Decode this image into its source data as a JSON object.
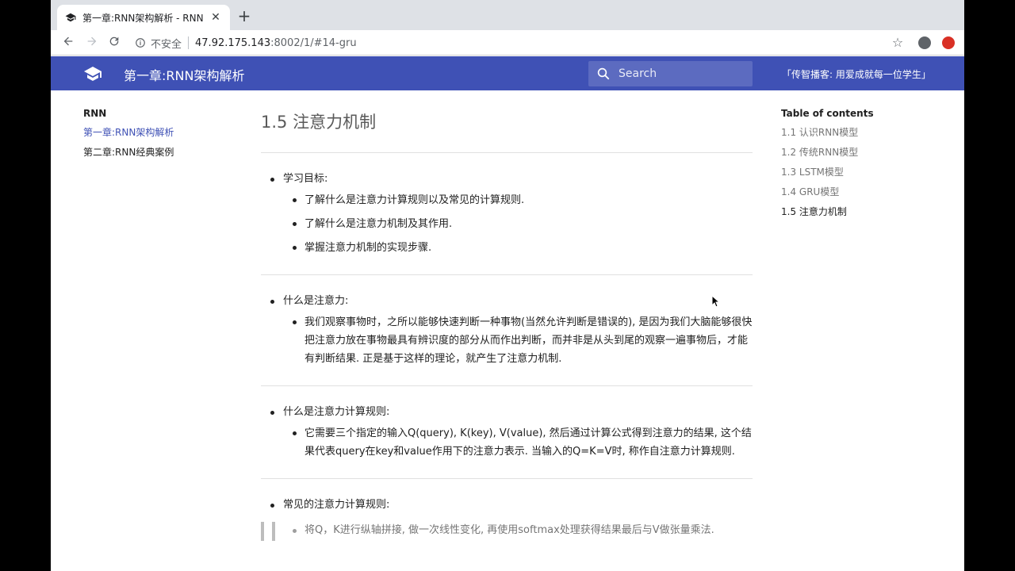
{
  "browser": {
    "tab_title": "第一章:RNN架构解析 - RNN",
    "tab_close": "✕",
    "new_tab": "+",
    "insecure_label": "不安全",
    "url_host": "47.92.175.143",
    "url_path": ":8002/1/#14-gru"
  },
  "header": {
    "title": "第一章:RNN架构解析",
    "search_placeholder": "Search",
    "slogan": "「传智播客: 用爱成就每一位学生」",
    "brand_color": "#3f51b5"
  },
  "left_nav": {
    "title": "RNN",
    "items": [
      {
        "label": "第一章:RNN架构解析"
      },
      {
        "label": "第二章:RNN经典案例"
      }
    ]
  },
  "toc": {
    "title": "Table of contents",
    "items": [
      {
        "label": "1.1 认识RNN模型"
      },
      {
        "label": "1.2 传统RNN模型"
      },
      {
        "label": "1.3 LSTM模型"
      },
      {
        "label": "1.4 GRU模型"
      },
      {
        "label": "1.5 注意力机制"
      }
    ]
  },
  "main": {
    "title": "1.5 注意力机制",
    "sections": [
      {
        "head": "学习目标:",
        "items": [
          "了解什么是注意力计算规则以及常见的计算规则.",
          "了解什么是注意力机制及其作用.",
          "掌握注意力机制的实现步骤."
        ]
      },
      {
        "head": "什么是注意力:",
        "items": [
          "我们观察事物时，之所以能够快速判断一种事物(当然允许判断是错误的), 是因为我们大脑能够很快把注意力放在事物最具有辨识度的部分从而作出判断，而并非是从头到尾的观察一遍事物后，才能有判断结果. 正是基于这样的理论，就产生了注意力机制."
        ]
      },
      {
        "head": "什么是注意力计算规则:",
        "items": [
          "它需要三个指定的输入Q(query), K(key), V(value), 然后通过计算公式得到注意力的结果, 这个结果代表query在key和value作用下的注意力表示. 当输入的Q=K=V时, 称作自注意力计算规则."
        ]
      },
      {
        "head": "常见的注意力计算规则:",
        "quote": "将Q，K进行纵轴拼接, 做一次线性变化, 再使用softmax处理获得结果最后与V做张量乘法."
      }
    ]
  }
}
